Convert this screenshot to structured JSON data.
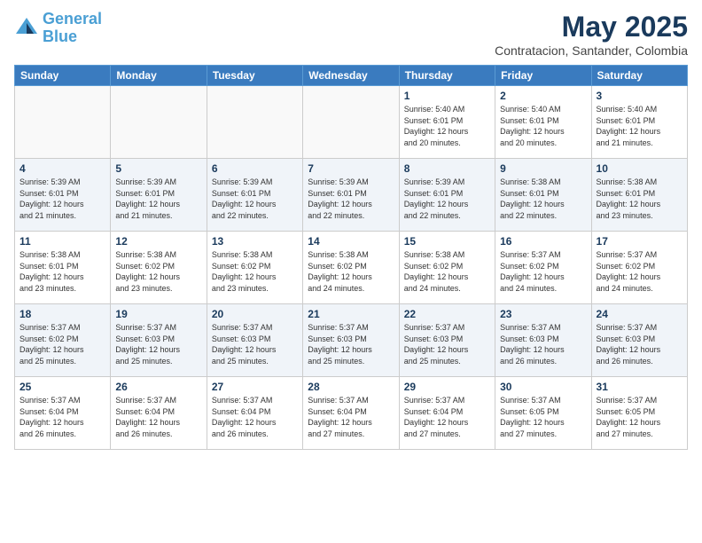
{
  "header": {
    "logo_line1": "General",
    "logo_line2": "Blue",
    "month_title": "May 2025",
    "location": "Contratacion, Santander, Colombia"
  },
  "weekdays": [
    "Sunday",
    "Monday",
    "Tuesday",
    "Wednesday",
    "Thursday",
    "Friday",
    "Saturday"
  ],
  "weeks": [
    [
      {
        "day": "",
        "info": ""
      },
      {
        "day": "",
        "info": ""
      },
      {
        "day": "",
        "info": ""
      },
      {
        "day": "",
        "info": ""
      },
      {
        "day": "1",
        "info": "Sunrise: 5:40 AM\nSunset: 6:01 PM\nDaylight: 12 hours\nand 20 minutes."
      },
      {
        "day": "2",
        "info": "Sunrise: 5:40 AM\nSunset: 6:01 PM\nDaylight: 12 hours\nand 20 minutes."
      },
      {
        "day": "3",
        "info": "Sunrise: 5:40 AM\nSunset: 6:01 PM\nDaylight: 12 hours\nand 21 minutes."
      }
    ],
    [
      {
        "day": "4",
        "info": "Sunrise: 5:39 AM\nSunset: 6:01 PM\nDaylight: 12 hours\nand 21 minutes."
      },
      {
        "day": "5",
        "info": "Sunrise: 5:39 AM\nSunset: 6:01 PM\nDaylight: 12 hours\nand 21 minutes."
      },
      {
        "day": "6",
        "info": "Sunrise: 5:39 AM\nSunset: 6:01 PM\nDaylight: 12 hours\nand 22 minutes."
      },
      {
        "day": "7",
        "info": "Sunrise: 5:39 AM\nSunset: 6:01 PM\nDaylight: 12 hours\nand 22 minutes."
      },
      {
        "day": "8",
        "info": "Sunrise: 5:39 AM\nSunset: 6:01 PM\nDaylight: 12 hours\nand 22 minutes."
      },
      {
        "day": "9",
        "info": "Sunrise: 5:38 AM\nSunset: 6:01 PM\nDaylight: 12 hours\nand 22 minutes."
      },
      {
        "day": "10",
        "info": "Sunrise: 5:38 AM\nSunset: 6:01 PM\nDaylight: 12 hours\nand 23 minutes."
      }
    ],
    [
      {
        "day": "11",
        "info": "Sunrise: 5:38 AM\nSunset: 6:01 PM\nDaylight: 12 hours\nand 23 minutes."
      },
      {
        "day": "12",
        "info": "Sunrise: 5:38 AM\nSunset: 6:02 PM\nDaylight: 12 hours\nand 23 minutes."
      },
      {
        "day": "13",
        "info": "Sunrise: 5:38 AM\nSunset: 6:02 PM\nDaylight: 12 hours\nand 23 minutes."
      },
      {
        "day": "14",
        "info": "Sunrise: 5:38 AM\nSunset: 6:02 PM\nDaylight: 12 hours\nand 24 minutes."
      },
      {
        "day": "15",
        "info": "Sunrise: 5:38 AM\nSunset: 6:02 PM\nDaylight: 12 hours\nand 24 minutes."
      },
      {
        "day": "16",
        "info": "Sunrise: 5:37 AM\nSunset: 6:02 PM\nDaylight: 12 hours\nand 24 minutes."
      },
      {
        "day": "17",
        "info": "Sunrise: 5:37 AM\nSunset: 6:02 PM\nDaylight: 12 hours\nand 24 minutes."
      }
    ],
    [
      {
        "day": "18",
        "info": "Sunrise: 5:37 AM\nSunset: 6:02 PM\nDaylight: 12 hours\nand 25 minutes."
      },
      {
        "day": "19",
        "info": "Sunrise: 5:37 AM\nSunset: 6:03 PM\nDaylight: 12 hours\nand 25 minutes."
      },
      {
        "day": "20",
        "info": "Sunrise: 5:37 AM\nSunset: 6:03 PM\nDaylight: 12 hours\nand 25 minutes."
      },
      {
        "day": "21",
        "info": "Sunrise: 5:37 AM\nSunset: 6:03 PM\nDaylight: 12 hours\nand 25 minutes."
      },
      {
        "day": "22",
        "info": "Sunrise: 5:37 AM\nSunset: 6:03 PM\nDaylight: 12 hours\nand 25 minutes."
      },
      {
        "day": "23",
        "info": "Sunrise: 5:37 AM\nSunset: 6:03 PM\nDaylight: 12 hours\nand 26 minutes."
      },
      {
        "day": "24",
        "info": "Sunrise: 5:37 AM\nSunset: 6:03 PM\nDaylight: 12 hours\nand 26 minutes."
      }
    ],
    [
      {
        "day": "25",
        "info": "Sunrise: 5:37 AM\nSunset: 6:04 PM\nDaylight: 12 hours\nand 26 minutes."
      },
      {
        "day": "26",
        "info": "Sunrise: 5:37 AM\nSunset: 6:04 PM\nDaylight: 12 hours\nand 26 minutes."
      },
      {
        "day": "27",
        "info": "Sunrise: 5:37 AM\nSunset: 6:04 PM\nDaylight: 12 hours\nand 26 minutes."
      },
      {
        "day": "28",
        "info": "Sunrise: 5:37 AM\nSunset: 6:04 PM\nDaylight: 12 hours\nand 27 minutes."
      },
      {
        "day": "29",
        "info": "Sunrise: 5:37 AM\nSunset: 6:04 PM\nDaylight: 12 hours\nand 27 minutes."
      },
      {
        "day": "30",
        "info": "Sunrise: 5:37 AM\nSunset: 6:05 PM\nDaylight: 12 hours\nand 27 minutes."
      },
      {
        "day": "31",
        "info": "Sunrise: 5:37 AM\nSunset: 6:05 PM\nDaylight: 12 hours\nand 27 minutes."
      }
    ]
  ]
}
